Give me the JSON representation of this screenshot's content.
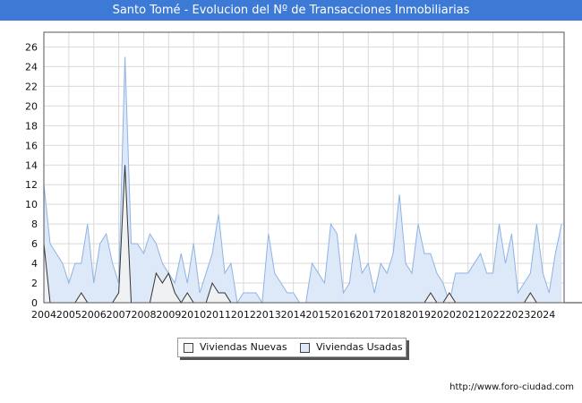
{
  "title": "Santo Tomé - Evolucion del Nº de Transacciones Inmobiliarias",
  "source": "http://www.foro-ciudad.com",
  "chart_data": {
    "type": "area",
    "x_labels": [
      "2004",
      "2005",
      "2006",
      "2007",
      "2008",
      "2009",
      "2010",
      "2011",
      "2012",
      "2013",
      "2014",
      "2015",
      "2016",
      "2017",
      "2018",
      "2019",
      "2020",
      "2021",
      "2022",
      "2023",
      "2024"
    ],
    "y_ticks": [
      0,
      2,
      4,
      6,
      8,
      10,
      12,
      14,
      16,
      18,
      20,
      22,
      24,
      26
    ],
    "ylim": [
      0,
      27.5
    ],
    "grid": true,
    "legend_position": "bottom",
    "period": "quarterly",
    "series": [
      {
        "name": "Viviendas Nuevas",
        "color": "#f2f2f2",
        "line_color": "#333333",
        "values": [
          6,
          0,
          0,
          0,
          0,
          0,
          1,
          0,
          0,
          0,
          0,
          0,
          1,
          14,
          0,
          0,
          0,
          0,
          3,
          2,
          3,
          1,
          0,
          1,
          0,
          0,
          0,
          2,
          1,
          1,
          0,
          0,
          0,
          0,
          0,
          0,
          0,
          0,
          0,
          0,
          0,
          0,
          0,
          0,
          0,
          0,
          0,
          0,
          0,
          0,
          0,
          0,
          0,
          0,
          0,
          0,
          0,
          0,
          0,
          0,
          0,
          0,
          1,
          0,
          0,
          1,
          0,
          0,
          0,
          0,
          0,
          0,
          0,
          0,
          0,
          0,
          0,
          0,
          1,
          0,
          0,
          0,
          0,
          0,
          0,
          0,
          0,
          0
        ]
      },
      {
        "name": "Viviendas Usadas",
        "color": "#dde9f8",
        "line_color": "#8fb3e2",
        "values": [
          12,
          6,
          5,
          4,
          2,
          4,
          4,
          8,
          2,
          6,
          7,
          4,
          2,
          25,
          6,
          6,
          5,
          7,
          6,
          4,
          3,
          2,
          5,
          2,
          6,
          1,
          3,
          5,
          9,
          3,
          4,
          0,
          1,
          1,
          1,
          0,
          7,
          3,
          2,
          1,
          1,
          0,
          0,
          4,
          3,
          2,
          8,
          7,
          1,
          2,
          7,
          3,
          4,
          1,
          4,
          3,
          5,
          11,
          4,
          3,
          8,
          5,
          5,
          3,
          2,
          0,
          3,
          3,
          3,
          4,
          5,
          3,
          3,
          8,
          4,
          7,
          1,
          2,
          3,
          8,
          3,
          1,
          5,
          8
        ]
      }
    ]
  }
}
